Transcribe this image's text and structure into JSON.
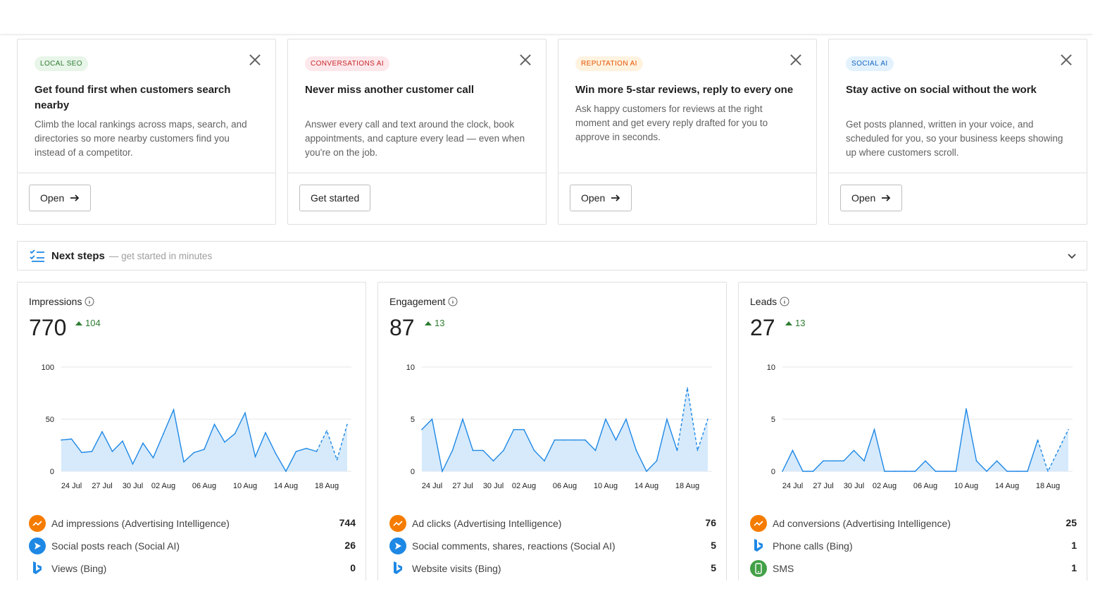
{
  "promos": [
    {
      "badge": "LOCAL SEO",
      "title": "Get found first when customers search nearby",
      "desc": "Climb the local rankings across maps, search, and directories so more nearby customers find you instead of a competitor.",
      "button": "Open"
    },
    {
      "badge": "CONVERSATIONS AI",
      "title": "Never miss another customer call",
      "desc": "Answer every call and text around the clock, book appointments, and capture every lead — even when you're on the job.",
      "button": "Get started"
    },
    {
      "badge": "REPUTATION AI",
      "title": "Win more 5-star reviews, reply to every one",
      "desc": "Ask happy customers for reviews at the right moment and get every reply drafted for you to approve in seconds.",
      "button": "Open"
    },
    {
      "badge": "SOCIAL AI",
      "title": "Stay active on social without the work",
      "desc": "Get posts planned, written in your voice, and scheduled for you, so your business keeps showing up where customers scroll.",
      "button": "Open"
    }
  ],
  "next_steps": {
    "title": "Next steps",
    "subtitle": "— get started in minutes"
  },
  "colors": {
    "accent": "#1e88e5",
    "positive": "#2e7d32",
    "area_fill": "#cfe6fb"
  },
  "metrics": [
    {
      "title": "Impressions",
      "value": "770",
      "delta": "104",
      "legend": [
        {
          "icon": "trend-icon",
          "label": "Ad impressions (Advertising Intelligence)",
          "value": "744"
        },
        {
          "icon": "send-icon",
          "label": "Social posts reach (Social AI)",
          "value": "26"
        },
        {
          "icon": "bing-icon",
          "label": "Views (Bing)",
          "value": "0"
        }
      ]
    },
    {
      "title": "Engagement",
      "value": "87",
      "delta": "13",
      "legend": [
        {
          "icon": "trend-icon",
          "label": "Ad clicks (Advertising Intelligence)",
          "value": "76"
        },
        {
          "icon": "send-icon",
          "label": "Social comments, shares, reactions (Social AI)",
          "value": "5"
        },
        {
          "icon": "bing-icon",
          "label": "Website visits (Bing)",
          "value": "5"
        }
      ]
    },
    {
      "title": "Leads",
      "value": "27",
      "delta": "13",
      "legend": [
        {
          "icon": "trend-icon",
          "label": "Ad conversions (Advertising Intelligence)",
          "value": "25"
        },
        {
          "icon": "bing-icon",
          "label": "Phone calls (Bing)",
          "value": "1"
        },
        {
          "icon": "phone-icon",
          "label": "SMS",
          "value": "1"
        }
      ]
    }
  ],
  "chart_data": [
    {
      "type": "area",
      "title": "Impressions",
      "x": [
        "23 Jul",
        "24 Jul",
        "25 Jul",
        "26 Jul",
        "27 Jul",
        "28 Jul",
        "29 Jul",
        "30 Jul",
        "31 Jul",
        "01 Aug",
        "02 Aug",
        "03 Aug",
        "04 Aug",
        "05 Aug",
        "06 Aug",
        "07 Aug",
        "08 Aug",
        "09 Aug",
        "10 Aug",
        "11 Aug",
        "12 Aug",
        "13 Aug",
        "14 Aug",
        "15 Aug",
        "16 Aug",
        "17 Aug",
        "18 Aug",
        "19 Aug",
        "20 Aug"
      ],
      "x_ticks": [
        "24 Jul",
        "27 Jul",
        "30 Jul",
        "02 Aug",
        "06 Aug",
        "10 Aug",
        "14 Aug",
        "18 Aug"
      ],
      "values": [
        30,
        31,
        18,
        19,
        38,
        19,
        29,
        7,
        27,
        13,
        36,
        59,
        9,
        18,
        21,
        45,
        28,
        36,
        56,
        14,
        37,
        17,
        0,
        19,
        22,
        19,
        39,
        11,
        45
      ],
      "dashed_from_index": 25,
      "ylim": [
        0,
        100
      ],
      "y_ticks": [
        0,
        50,
        100
      ]
    },
    {
      "type": "area",
      "title": "Engagement",
      "x": [
        "23 Jul",
        "24 Jul",
        "25 Jul",
        "26 Jul",
        "27 Jul",
        "28 Jul",
        "29 Jul",
        "30 Jul",
        "31 Jul",
        "01 Aug",
        "02 Aug",
        "03 Aug",
        "04 Aug",
        "05 Aug",
        "06 Aug",
        "07 Aug",
        "08 Aug",
        "09 Aug",
        "10 Aug",
        "11 Aug",
        "12 Aug",
        "13 Aug",
        "14 Aug",
        "15 Aug",
        "16 Aug",
        "17 Aug",
        "18 Aug",
        "19 Aug",
        "20 Aug"
      ],
      "x_ticks": [
        "24 Jul",
        "27 Jul",
        "30 Jul",
        "02 Aug",
        "06 Aug",
        "10 Aug",
        "14 Aug",
        "18 Aug"
      ],
      "values": [
        4,
        5,
        0,
        2,
        5,
        2,
        2,
        1,
        2,
        4,
        4,
        2,
        1,
        3,
        3,
        3,
        3,
        2,
        5,
        3,
        5,
        2,
        0,
        1,
        5,
        2,
        8,
        2,
        5
      ],
      "dashed_from_index": 25,
      "ylim": [
        0,
        10
      ],
      "y_ticks": [
        0,
        5,
        10
      ]
    },
    {
      "type": "area",
      "title": "Leads",
      "x": [
        "23 Jul",
        "24 Jul",
        "25 Jul",
        "26 Jul",
        "27 Jul",
        "28 Jul",
        "29 Jul",
        "30 Jul",
        "31 Jul",
        "01 Aug",
        "02 Aug",
        "03 Aug",
        "04 Aug",
        "05 Aug",
        "06 Aug",
        "07 Aug",
        "08 Aug",
        "09 Aug",
        "10 Aug",
        "11 Aug",
        "12 Aug",
        "13 Aug",
        "14 Aug",
        "15 Aug",
        "16 Aug",
        "17 Aug",
        "18 Aug",
        "19 Aug",
        "20 Aug"
      ],
      "x_ticks": [
        "24 Jul",
        "27 Jul",
        "30 Jul",
        "02 Aug",
        "06 Aug",
        "10 Aug",
        "14 Aug",
        "18 Aug"
      ],
      "values": [
        0,
        2,
        0,
        0,
        1,
        1,
        1,
        2,
        1,
        4,
        0,
        0,
        0,
        0,
        1,
        0,
        0,
        0,
        6,
        1,
        0,
        1,
        0,
        0,
        0,
        3,
        0,
        2,
        4
      ],
      "dashed_from_index": 25,
      "ylim": [
        0,
        10
      ],
      "y_ticks": [
        0,
        5,
        10
      ]
    }
  ]
}
